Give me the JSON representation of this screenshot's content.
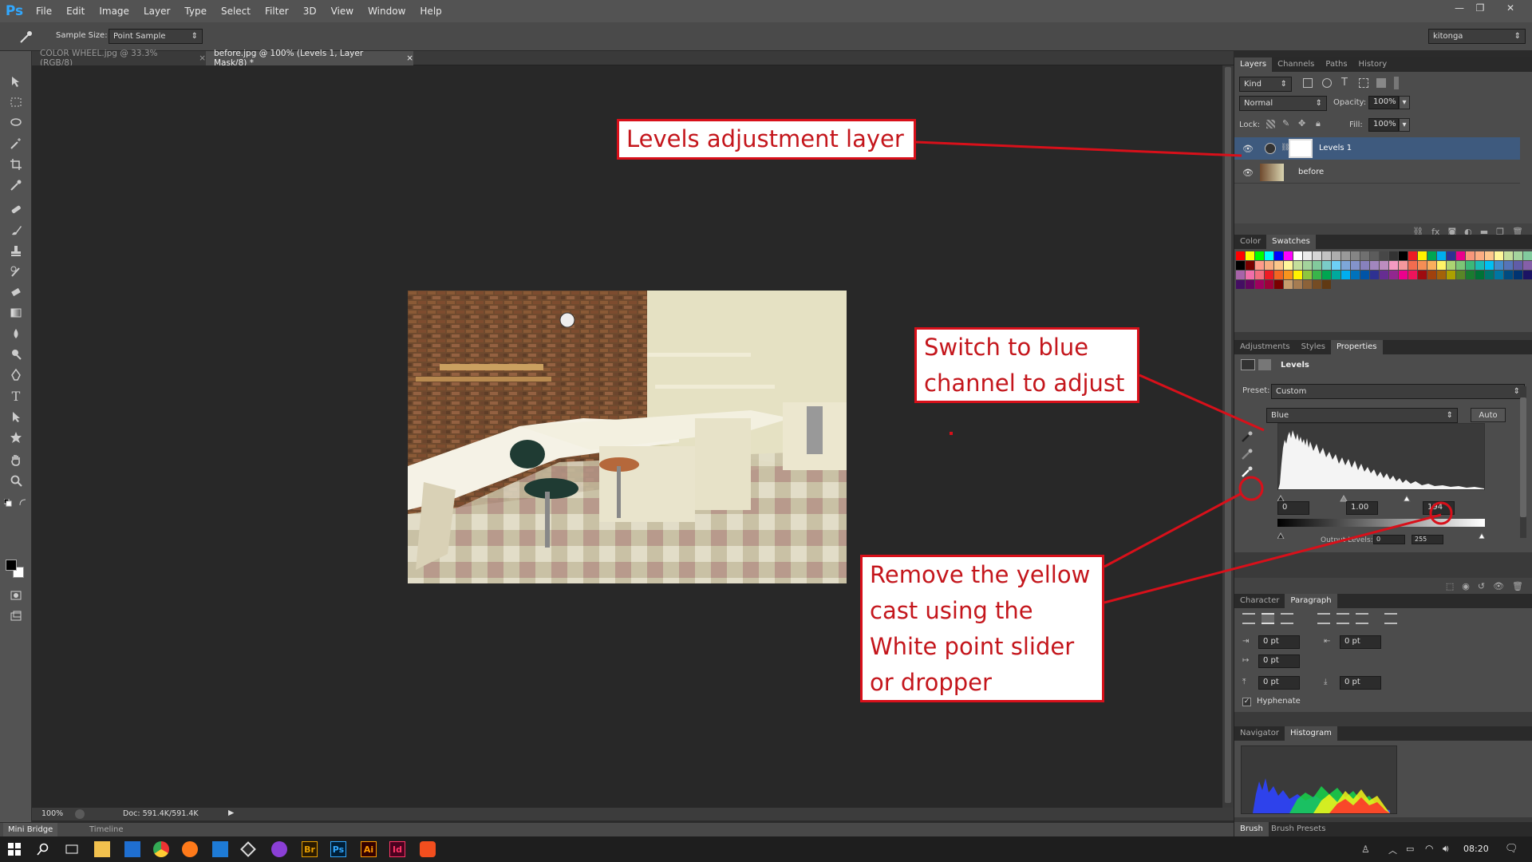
{
  "app": {
    "logo": "Ps"
  },
  "menu": [
    "File",
    "Edit",
    "Image",
    "Layer",
    "Type",
    "Select",
    "Filter",
    "3D",
    "View",
    "Window",
    "Help"
  ],
  "window_controls": {
    "minimize": "—",
    "restore": "❐",
    "close": "✕"
  },
  "options_bar": {
    "sample_size_label": "Sample Size:",
    "sample_size_value": "Point Sample",
    "workspace": "kitonga"
  },
  "doc_tabs": [
    {
      "label": "COLOR WHEEL.jpg @ 33.3% (RGB/8)",
      "close": "×",
      "active": false
    },
    {
      "label": "before.jpg @ 100% (Levels 1, Layer Mask/8) *",
      "close": "×",
      "active": true
    }
  ],
  "status": {
    "zoom": "100%",
    "doc": "Doc: 591.4K/591.4K"
  },
  "bottom_tabs": [
    "Mini Bridge",
    "Timeline"
  ],
  "layers_panel": {
    "tabs": [
      "Layers",
      "Channels",
      "Paths",
      "History"
    ],
    "kind_label": "Kind",
    "blend_mode": "Normal",
    "opacity_label": "Opacity:",
    "opacity_value": "100%",
    "lock_label": "Lock:",
    "fill_label": "Fill:",
    "fill_value": "100%",
    "layers": [
      {
        "name": "Levels 1",
        "selected": true
      },
      {
        "name": "before",
        "selected": false
      }
    ]
  },
  "swatches_panel": {
    "tabs": [
      "Color",
      "Swatches"
    ]
  },
  "properties_panel": {
    "tabs": [
      "Adjustments",
      "Styles",
      "Properties"
    ],
    "title": "Levels",
    "preset_label": "Preset:",
    "preset_value": "Custom",
    "channel": "Blue",
    "auto_label": "Auto",
    "input_black": "0",
    "input_gamma": "1.00",
    "input_white": "194",
    "output_levels_label": "Output Levels:",
    "output_black": "0",
    "output_white": "255"
  },
  "paragraph_panel": {
    "tabs": [
      "Character",
      "Paragraph"
    ],
    "indent_left": "0 pt",
    "indent_right": "0 pt",
    "indent_first": "0 pt",
    "space_before": "0 pt",
    "space_after": "0 pt",
    "hyphenate_label": "Hyphenate"
  },
  "histogram_panel": {
    "tabs": [
      "Navigator",
      "Histogram"
    ]
  },
  "brush_tabs": [
    "Brush",
    "Brush Presets"
  ],
  "taskbar": {
    "time": "08:20"
  },
  "annotations": {
    "levels_layer": "Levels adjustment layer",
    "blue_channel_l1": "Switch to blue",
    "blue_channel_l2": "channel to adjust",
    "yellow_l1": "Remove the yellow",
    "yellow_l2": "cast using the",
    "yellow_l3": "White point slider",
    "yellow_l4": "or dropper"
  },
  "colors": {
    "annotation": "#d8101a",
    "selected_layer": "#3e5a7e",
    "ps_blue": "#31a8ff"
  }
}
